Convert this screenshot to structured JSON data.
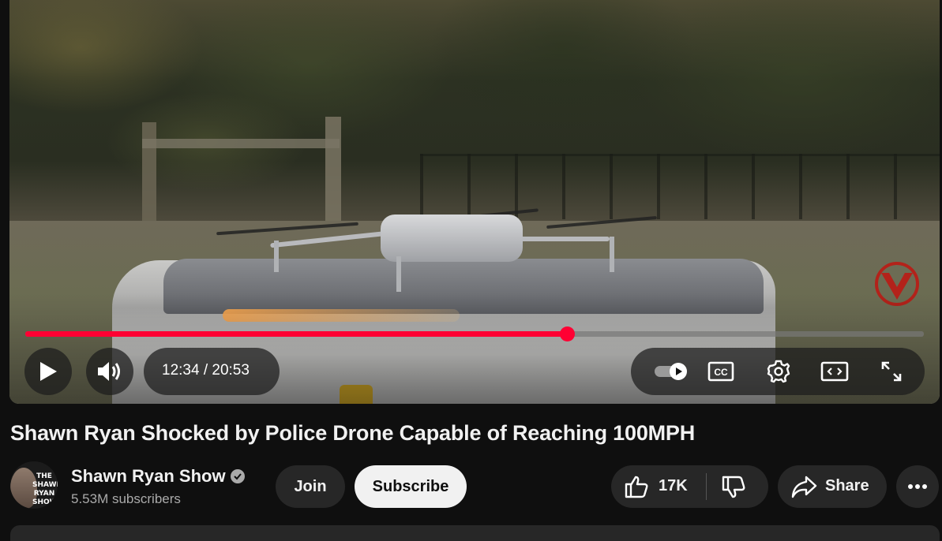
{
  "player": {
    "progress_fraction": 0.603,
    "current_time": "12:34",
    "duration": "20:53",
    "time_display": "12:34 / 20:53",
    "colors": {
      "progress": "#ff0033",
      "track": "#7a7a7a"
    },
    "controls": {
      "play_icon": "play-icon",
      "volume_icon": "volume-icon",
      "autoplay_icon": "autoplay-toggle-icon",
      "captions_label": "CC",
      "settings_icon": "gear-icon",
      "theater_icon": "theater-mode-icon",
      "fullscreen_icon": "fullscreen-icon"
    }
  },
  "video": {
    "title": "Shawn Ryan Shocked by Police Drone Capable of Reaching 100MPH"
  },
  "channel": {
    "name": "Shawn Ryan Show",
    "subscribers": "5.53M subscribers",
    "avatar_text": "THE SHAWN RYAN SHOW",
    "verified_icon": "verified-check-icon"
  },
  "actions": {
    "join_label": "Join",
    "subscribe_label": "Subscribe",
    "like_count": "17K",
    "share_label": "Share",
    "more_icon": "more-horizontal-icon"
  }
}
